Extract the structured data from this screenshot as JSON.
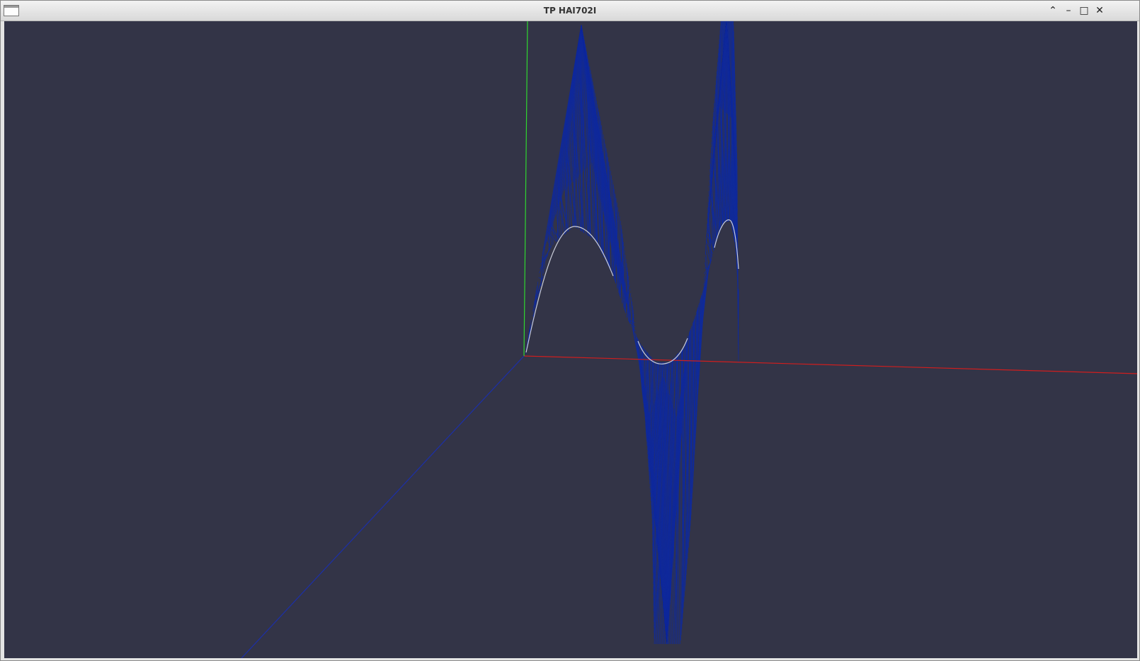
{
  "window": {
    "title": "TP HAI702I",
    "icons": {
      "app": "window-app-icon",
      "shade": "chevron-up-icon",
      "minimize": "minimize-icon",
      "maximize": "maximize-icon",
      "close": "close-icon"
    },
    "glyphs": {
      "shade": "⌃",
      "minimize": "–",
      "maximize": "□",
      "close": "✕"
    }
  },
  "scene": {
    "background": "#333447",
    "axis_colors": {
      "x": "#d01e1e",
      "y": "#2fd62f",
      "z": "#1c2fa8"
    },
    "mesh_color": "#0f2a9c",
    "curve_highlight": "#c9ccd8"
  }
}
